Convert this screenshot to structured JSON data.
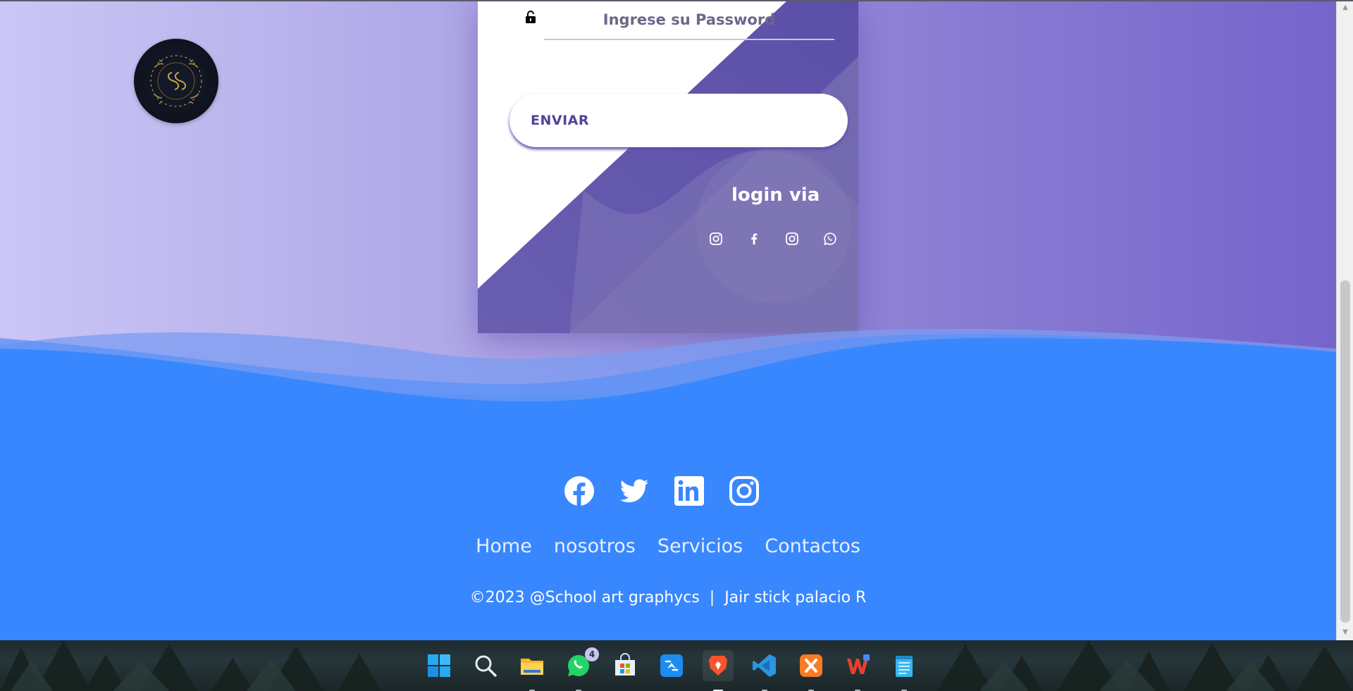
{
  "login": {
    "password_placeholder": "Ingrese su Password",
    "submit_label": "ENVIAR",
    "login_via_label": "login via",
    "social_icons": [
      "instagram-icon",
      "facebook-icon",
      "instagram-icon",
      "whatsapp-icon"
    ]
  },
  "footer": {
    "social_icons": [
      "facebook-icon",
      "twitter-icon",
      "linkedin-icon",
      "instagram-icon"
    ],
    "nav": [
      "Home",
      "nosotros",
      "Servicios",
      "Contactos"
    ],
    "copyright": "©2023 @School art graphycs  |  Jair stick palacio R"
  },
  "taskbar": {
    "apps": [
      "windows-start",
      "search",
      "file-explorer",
      "whatsapp",
      "microsoft-store",
      "app-link",
      "brave-browser",
      "vscode",
      "xampp",
      "wps-office",
      "notepad"
    ],
    "whatsapp_badge": "4"
  },
  "colors": {
    "footer_blue": "#3887fe",
    "hero_left": "#cbc6f6",
    "hero_right": "#7664cb",
    "card_purple": "#6a5fb0",
    "button_text": "#4f449a"
  }
}
